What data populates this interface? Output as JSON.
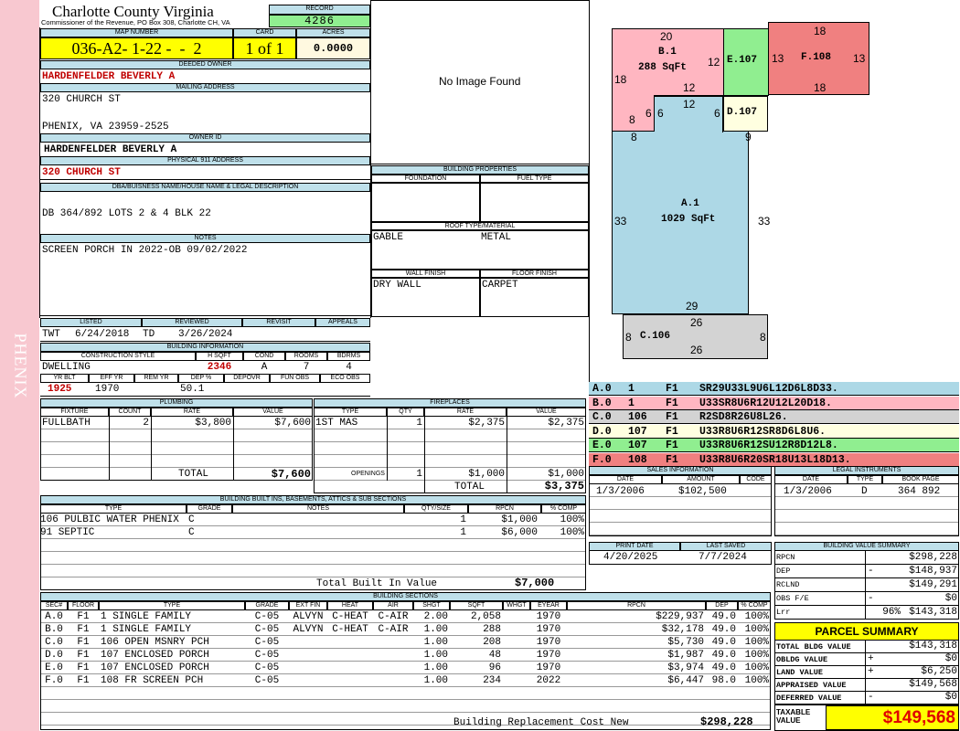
{
  "side_label": "PHENIX",
  "county": {
    "title": "Charlotte County Virginia",
    "subtitle": "Commissioner of the Revenue, PO Box 308, Charlotte CH, VA"
  },
  "record": {
    "label": "RECORD",
    "value": "4286"
  },
  "map": {
    "label": "MAP NUMBER",
    "value": "036-A2- 1-22 -  -  2",
    "card_label": "CARD",
    "card": "1 of 1",
    "acres_label": "ACRES",
    "acres": "0.0000"
  },
  "deeded_owner": {
    "label": "DEEDED OWNER",
    "value": "HARDENFELDER BEVERLY A"
  },
  "mailing": {
    "label": "MAILING ADDRESS",
    "line1": "320 CHURCH ST",
    "line2": "PHENIX, VA 23959-2525"
  },
  "owner_id": {
    "label": "OWNER ID",
    "value": "HARDENFELDER BEVERLY A"
  },
  "physical": {
    "label": "PHYSICAL 911 ADDRESS",
    "value": "320 CHURCH ST"
  },
  "dba": {
    "label": "DBA/BUISNESS NAME/HOUSE NAME & LEGAL DESCRIPTION",
    "value": "DB 364/892 LOTS 2 & 4 BLK 22"
  },
  "notes": {
    "label": "NOTES",
    "value": "SCREEN PORCH IN 2022-OB 09/02/2022"
  },
  "image_placeholder": "No Image Found",
  "building_properties": {
    "label": "BUILDING PROPERTIES",
    "foundation_label": "FOUNDATION",
    "fuel_label": "FUEL TYPE",
    "foundation": "",
    "fuel": "",
    "roof_label": "ROOF TYPE/MATERIAL",
    "roof_type": "GABLE",
    "roof_material": "METAL",
    "wall_label": "WALL FINISH",
    "floor_label": "FLOOR FINISH",
    "wall": "DRY WALL",
    "floor": "CARPET"
  },
  "review": {
    "listed_label": "LISTED",
    "reviewed_label": "REVIEWED",
    "revisit_label": "REVISIT",
    "appeals_label": "APPEALS",
    "listed_by": "TWT",
    "listed_date": "6/24/2018",
    "reviewed_by": "TD",
    "reviewed_date": "3/26/2024"
  },
  "building_info": {
    "label": "BUILDING INFORMATION",
    "style_label": "CONSTRUCTION STYLE",
    "hsqft_label": "H SQFT",
    "cond_label": "COND",
    "rooms_label": "ROOMS",
    "bdrms_label": "BDRMS",
    "style": "DWELLING",
    "hsqft": "2346",
    "cond": "A",
    "rooms": "7",
    "bdrms": "4",
    "yrblt_label": "YR BLT",
    "effyr_label": "EFF YR",
    "remyr_label": "REM YR",
    "dep_label": "DEP %",
    "depovr_label": "DEPOVR",
    "funobs_label": "FUN OBS",
    "ecoobs_label": "ECO OBS",
    "yrblt": "1925",
    "effyr": "1970",
    "remyr": "",
    "dep": "50.1"
  },
  "plumbing": {
    "label": "PLUMBING",
    "headers": [
      "FIXTURE",
      "COUNT",
      "RATE",
      "VALUE"
    ],
    "rows": [
      [
        "FULLBATH",
        "2",
        "$3,800",
        "$7,600"
      ]
    ],
    "total_label": "TOTAL",
    "total": "$7,600"
  },
  "fireplaces": {
    "label": "FIREPLACES",
    "headers": [
      "TYPE",
      "QTY",
      "RATE",
      "VALUE"
    ],
    "rows": [
      [
        "1ST MAS",
        "1",
        "$2,375",
        "$2,375"
      ]
    ],
    "openings_label": "OPENINGS",
    "openings": [
      "1",
      "$1,000",
      "$1,000"
    ],
    "total_label": "TOTAL",
    "total": "$3,375"
  },
  "builtins": {
    "label": "BUILDING BUILT INS, BASEMENTS, ATTICS & SUB SECTIONS",
    "headers": [
      "TYPE",
      "GRADE",
      "NOTES",
      "QTY/SIZE",
      "RPCN",
      "% COMP"
    ],
    "rows": [
      [
        "106 PULBIC WATER PHENIX",
        "C",
        "",
        "1",
        "$1,000",
        "100%"
      ],
      [
        "91 SEPTIC",
        "C",
        "",
        "1",
        "$6,000",
        "100%"
      ]
    ],
    "total_label": "Total Built In Value",
    "total": "$7,000"
  },
  "sections": {
    "label": "BUILDING SECTIONS",
    "headers": [
      "SEC#",
      "FLOOR",
      "TYPE",
      "GRADE",
      "EXT FIN",
      "HEAT",
      "AIR",
      "SHGT",
      "SQFT",
      "WHGT",
      "EYEAR",
      "RPCN",
      "DEP",
      "% COMP"
    ],
    "rows": [
      [
        "A.0",
        "F1",
        "1 SINGLE FAMILY",
        "C-05",
        "ALVYN",
        "C-HEAT",
        "C-AIR",
        "2.00",
        "2,058",
        "",
        "1970",
        "$229,937",
        "49.0",
        "100%"
      ],
      [
        "B.0",
        "F1",
        "1 SINGLE FAMILY",
        "C-05",
        "ALVYN",
        "C-HEAT",
        "C-AIR",
        "1.00",
        "288",
        "",
        "1970",
        "$32,178",
        "49.0",
        "100%"
      ],
      [
        "C.0",
        "F1",
        "106 OPEN MSNRY PCH",
        "C-05",
        "",
        "",
        "",
        "1.00",
        "208",
        "",
        "1970",
        "$5,730",
        "49.0",
        "100%"
      ],
      [
        "D.0",
        "F1",
        "107 ENCLOSED PORCH",
        "C-05",
        "",
        "",
        "",
        "1.00",
        "48",
        "",
        "1970",
        "$1,987",
        "49.0",
        "100%"
      ],
      [
        "E.0",
        "F1",
        "107 ENCLOSED PORCH",
        "C-05",
        "",
        "",
        "",
        "1.00",
        "96",
        "",
        "1970",
        "$3,974",
        "49.0",
        "100%"
      ],
      [
        "F.0",
        "F1",
        "108 FR SCREEN PCH",
        "C-05",
        "",
        "",
        "",
        "1.00",
        "234",
        "",
        "2022",
        "$6,447",
        "98.0",
        "100%"
      ]
    ],
    "replacement_label": "Building Replacement Cost New",
    "replacement": "$298,228"
  },
  "sketch": {
    "A": {
      "label": "A.1",
      "area": "1029 SqFt",
      "d": [
        "8",
        "9",
        "33",
        "33",
        "29"
      ],
      "color": "#add8e6"
    },
    "B": {
      "label": "B.1",
      "area": "288 SqFt",
      "d": [
        "20",
        "18",
        "12",
        "12",
        "8",
        "6",
        "6"
      ],
      "color": "#ffb6c1"
    },
    "C": {
      "label": "C.106",
      "d": [
        "26",
        "8",
        "8",
        "26"
      ],
      "color": "#d3d3d3"
    },
    "D": {
      "label": "D.107",
      "d": [
        "12",
        "6"
      ],
      "color": "#ffffe0"
    },
    "E": {
      "label": "E.107",
      "d": [
        "13"
      ],
      "color": "#90ee90"
    },
    "F": {
      "label": "F.108",
      "d": [
        "18",
        "13",
        "13",
        "18"
      ],
      "color": "#f08080"
    }
  },
  "legend": [
    {
      "sec": "A.0",
      "n": "1",
      "fl": "F1",
      "path": "SR29U33L9U6L12D6L8D33.",
      "color": "#add8e6"
    },
    {
      "sec": "B.0",
      "n": "1",
      "fl": "F1",
      "path": "U33SR8U6R12U12L20D18.",
      "color": "#ffb6c1"
    },
    {
      "sec": "C.0",
      "n": "106",
      "fl": "F1",
      "path": "R2SD8R26U8L26.",
      "color": "#d3d3d3"
    },
    {
      "sec": "D.0",
      "n": "107",
      "fl": "F1",
      "path": "U33R8U6R12SR8D6L8U6.",
      "color": "#ffffe0"
    },
    {
      "sec": "E.0",
      "n": "107",
      "fl": "F1",
      "path": "U33R8U6R12SU12R8D12L8.",
      "color": "#90ee90"
    },
    {
      "sec": "F.0",
      "n": "108",
      "fl": "F1",
      "path": "U33R8U6R20SR18U13L18D13.",
      "color": "#f08080"
    }
  ],
  "sales": {
    "label": "SALES INFORMATION",
    "headers": [
      "DATE",
      "AMOUNT",
      "CODE"
    ],
    "rows": [
      [
        "1/3/2006",
        "$102,500",
        ""
      ]
    ]
  },
  "legal": {
    "label": "LEGAL INSTRUMENTS",
    "headers": [
      "DATE",
      "TYPE",
      "BOOK PAGE"
    ],
    "rows": [
      [
        "1/3/2006",
        "D",
        "364 892"
      ]
    ]
  },
  "print": {
    "print_label": "PRINT DATE",
    "saved_label": "LAST SAVED",
    "print_date": "4/20/2025",
    "last_saved": "7/7/2024"
  },
  "value_summary": {
    "label": "BUILDING VALUE SUMMARY",
    "rows": [
      [
        "RPCN",
        "",
        "$298,228"
      ],
      [
        "DEP",
        "-",
        "$148,937"
      ],
      [
        "RCLND",
        "",
        "$149,291"
      ],
      [
        "OBS F/E",
        "-",
        "$0"
      ],
      [
        "Lrr",
        "96%",
        "$143,318"
      ]
    ]
  },
  "parcel": {
    "label": "PARCEL SUMMARY",
    "rows": [
      [
        "TOTAL BLDG VALUE",
        "",
        "$143,318"
      ],
      [
        "OBLDG VALUE",
        "+",
        "$0"
      ],
      [
        "LAND VALUE",
        "+",
        "$6,250"
      ],
      [
        "APPRAISED VALUE",
        "",
        "$149,568"
      ],
      [
        "DEFERRED VALUE",
        "-",
        "$0"
      ]
    ],
    "taxable_label": "TAXABLE VALUE",
    "taxable": "$149,568"
  }
}
